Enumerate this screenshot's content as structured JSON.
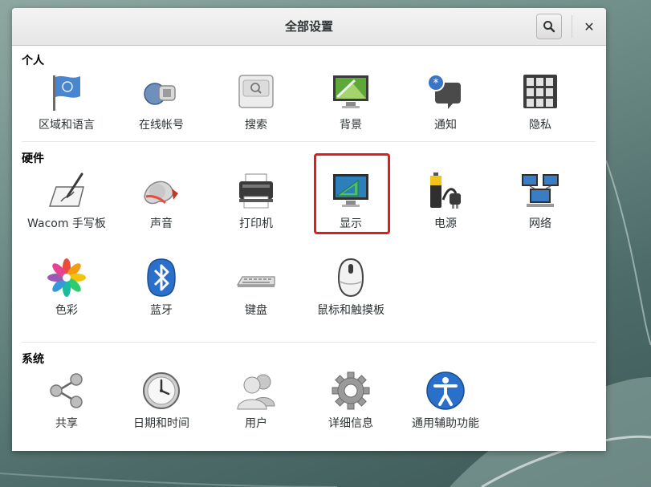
{
  "window": {
    "title": "全部设置"
  },
  "sections": {
    "personal": {
      "title": "个人",
      "items": [
        {
          "label": "区域和语言",
          "icon": "region-flag-icon"
        },
        {
          "label": "在线帐号",
          "icon": "online-accounts-icon"
        },
        {
          "label": "搜索",
          "icon": "search-settings-icon"
        },
        {
          "label": "背景",
          "icon": "background-icon"
        },
        {
          "label": "通知",
          "icon": "notifications-icon"
        },
        {
          "label": "隐私",
          "icon": "privacy-icon"
        }
      ]
    },
    "hardware": {
      "title": "硬件",
      "items": [
        {
          "label": "Wacom 手写板",
          "icon": "wacom-tablet-icon"
        },
        {
          "label": "声音",
          "icon": "sound-icon"
        },
        {
          "label": "打印机",
          "icon": "printer-icon"
        },
        {
          "label": "显示",
          "icon": "display-icon"
        },
        {
          "label": "电源",
          "icon": "power-icon"
        },
        {
          "label": "网络",
          "icon": "network-icon"
        },
        {
          "label": "色彩",
          "icon": "color-icon"
        },
        {
          "label": "蓝牙",
          "icon": "bluetooth-icon"
        },
        {
          "label": "键盘",
          "icon": "keyboard-icon"
        },
        {
          "label": "鼠标和触摸板",
          "icon": "mouse-touchpad-icon"
        }
      ]
    },
    "system": {
      "title": "系统",
      "items": [
        {
          "label": "共享",
          "icon": "sharing-icon"
        },
        {
          "label": "日期和时间",
          "icon": "date-time-icon"
        },
        {
          "label": "用户",
          "icon": "users-icon"
        },
        {
          "label": "详细信息",
          "icon": "details-gear-icon"
        },
        {
          "label": "通用辅助功能",
          "icon": "accessibility-icon"
        }
      ]
    }
  },
  "colors": {
    "highlight": "#e51c1c",
    "accent": "#3465a4"
  }
}
